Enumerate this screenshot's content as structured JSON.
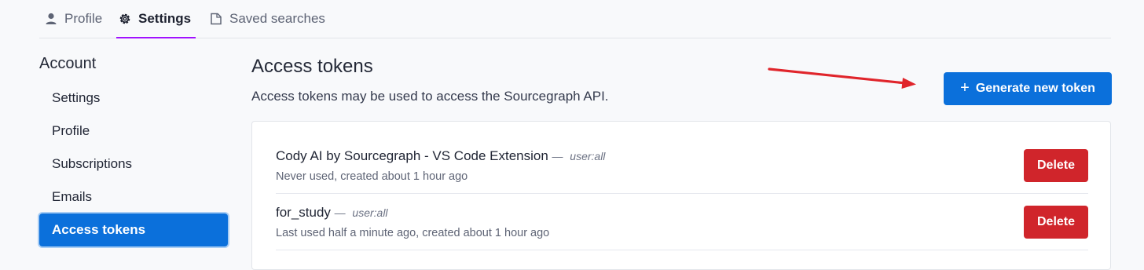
{
  "tabs": [
    {
      "label": "Profile",
      "icon": "user-icon"
    },
    {
      "label": "Settings",
      "icon": "gear-icon",
      "active": true
    },
    {
      "label": "Saved searches",
      "icon": "saved-search-icon"
    }
  ],
  "sidebar": {
    "header": "Account",
    "items": [
      {
        "label": "Settings"
      },
      {
        "label": "Profile"
      },
      {
        "label": "Subscriptions"
      },
      {
        "label": "Emails"
      },
      {
        "label": "Access tokens",
        "active": true
      }
    ]
  },
  "main": {
    "title": "Access tokens",
    "description": "Access tokens may be used to access the Sourcegraph API.",
    "generate_button": {
      "icon": "plus-icon",
      "label": "Generate new token"
    },
    "tokens": [
      {
        "name": "Cody AI by Sourcegraph - VS Code Extension",
        "scope": "user:all",
        "meta": "Never used, created about 1 hour ago",
        "delete_label": "Delete"
      },
      {
        "name": "for_study",
        "scope": "user:all",
        "meta": "Last used half a minute ago, created about 1 hour ago",
        "delete_label": "Delete"
      }
    ],
    "scope_separator": "—"
  },
  "colors": {
    "primary": "#0b70db",
    "danger": "#d0252b",
    "active_tab_underline": "#a112ff",
    "annotation_arrow": "#e0252b"
  }
}
